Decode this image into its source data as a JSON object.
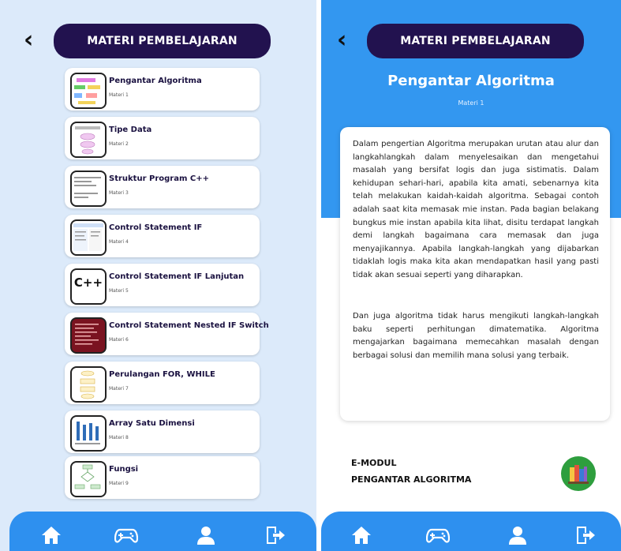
{
  "left": {
    "header_title": "MATERI PEMBELAJARAN",
    "back_label": "‹",
    "items": [
      {
        "title": "Pengantar Algoritma",
        "subtitle": "Materi 1"
      },
      {
        "title": "Tipe Data",
        "subtitle": "Materi 2"
      },
      {
        "title": "Struktur Program C++",
        "subtitle": "Materi 3"
      },
      {
        "title": "Control Statement IF",
        "subtitle": "Materi 4"
      },
      {
        "title": "Control Statement IF Lanjutan",
        "subtitle": "Materi 5"
      },
      {
        "title": "Control Statement Nested IF Switch",
        "subtitle": "Materi 6"
      },
      {
        "title": "Perulangan FOR, WHILE",
        "subtitle": "Materi 7"
      },
      {
        "title": "Array Satu Dimensi",
        "subtitle": "Materi 8"
      },
      {
        "title": "Fungsi",
        "subtitle": "Materi 9"
      }
    ],
    "thumb_cpp_text": "C++"
  },
  "right": {
    "header_title": "MATERI PEMBELAJARAN",
    "back_label": "‹",
    "page_title": "Pengantar Algoritma",
    "page_subtitle": "Materi 1",
    "paragraph1": "Dalam pengertian Algoritma merupakan urutan atau alur dan langkahlangkah dalam menyelesaikan dan mengetahui masalah yang bersifat logis dan juga sistimatis. Dalam kehidupan sehari-hari, apabila kita amati, sebenarnya kita telah melakukan kaidah-kaidah algoritma. Sebagai contoh adalah saat kita memasak mie instan. Pada bagian belakang bungkus mie instan apabila kita lihat, disitu terdapat langkah demi langkah bagaimana cara memasak dan juga menyajikannya. Apabila langkah-langkah yang dijabarkan tidaklah logis maka kita akan mendapatkan hasil yang pasti tidak akan sesuai seperti yang diharapkan.",
    "paragraph2": "Dan juga algoritma tidak harus mengikuti langkah-langkah baku seperti perhitungan dimatematika. Algoritma mengajarkan bagaimana memecahkan masalah dengan berbagai solusi dan memilih mana solusi yang terbaik.",
    "footer_line1": "E-MODUL",
    "footer_line2": "PENGANTAR ALGORITMA"
  },
  "nav": [
    "home-icon",
    "gamepad-icon",
    "user-icon",
    "exit-icon"
  ],
  "colors": {
    "header": "#22124f",
    "nav": "#2e90ef",
    "band": "#3397f0",
    "left_bg": "#dceafa"
  }
}
